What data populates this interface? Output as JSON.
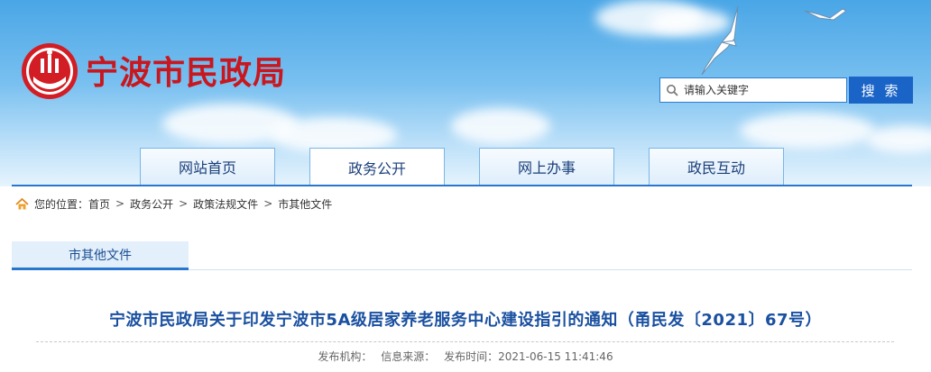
{
  "site": {
    "name": "宁波市民政局"
  },
  "search": {
    "placeholder": "请输入关键字",
    "button_label": "搜 索"
  },
  "nav": {
    "tabs": [
      {
        "label": "网站首页"
      },
      {
        "label": "政务公开"
      },
      {
        "label": "网上办事"
      },
      {
        "label": "政民互动"
      }
    ],
    "active": "政务公开"
  },
  "breadcrumb": {
    "prefix": "您的位置：",
    "items": [
      "首页",
      "政务公开",
      "政策法规文件",
      "市其他文件"
    ],
    "separator": ">"
  },
  "section": {
    "title": "市其他文件"
  },
  "article": {
    "title": "宁波市民政局关于印发宁波市5A级居家养老服务中心建设指引的通知（甬民发〔2021〕67号）",
    "meta": {
      "publisher_label": "发布机构：",
      "info_source_label": "信息来源：",
      "time_label": "发布时间：",
      "time_value": "2021-06-15 11:41:46"
    }
  },
  "colors": {
    "brand_red": "#c8171e",
    "nav_blue": "#1a64c7",
    "title_blue": "#1a50a0"
  }
}
